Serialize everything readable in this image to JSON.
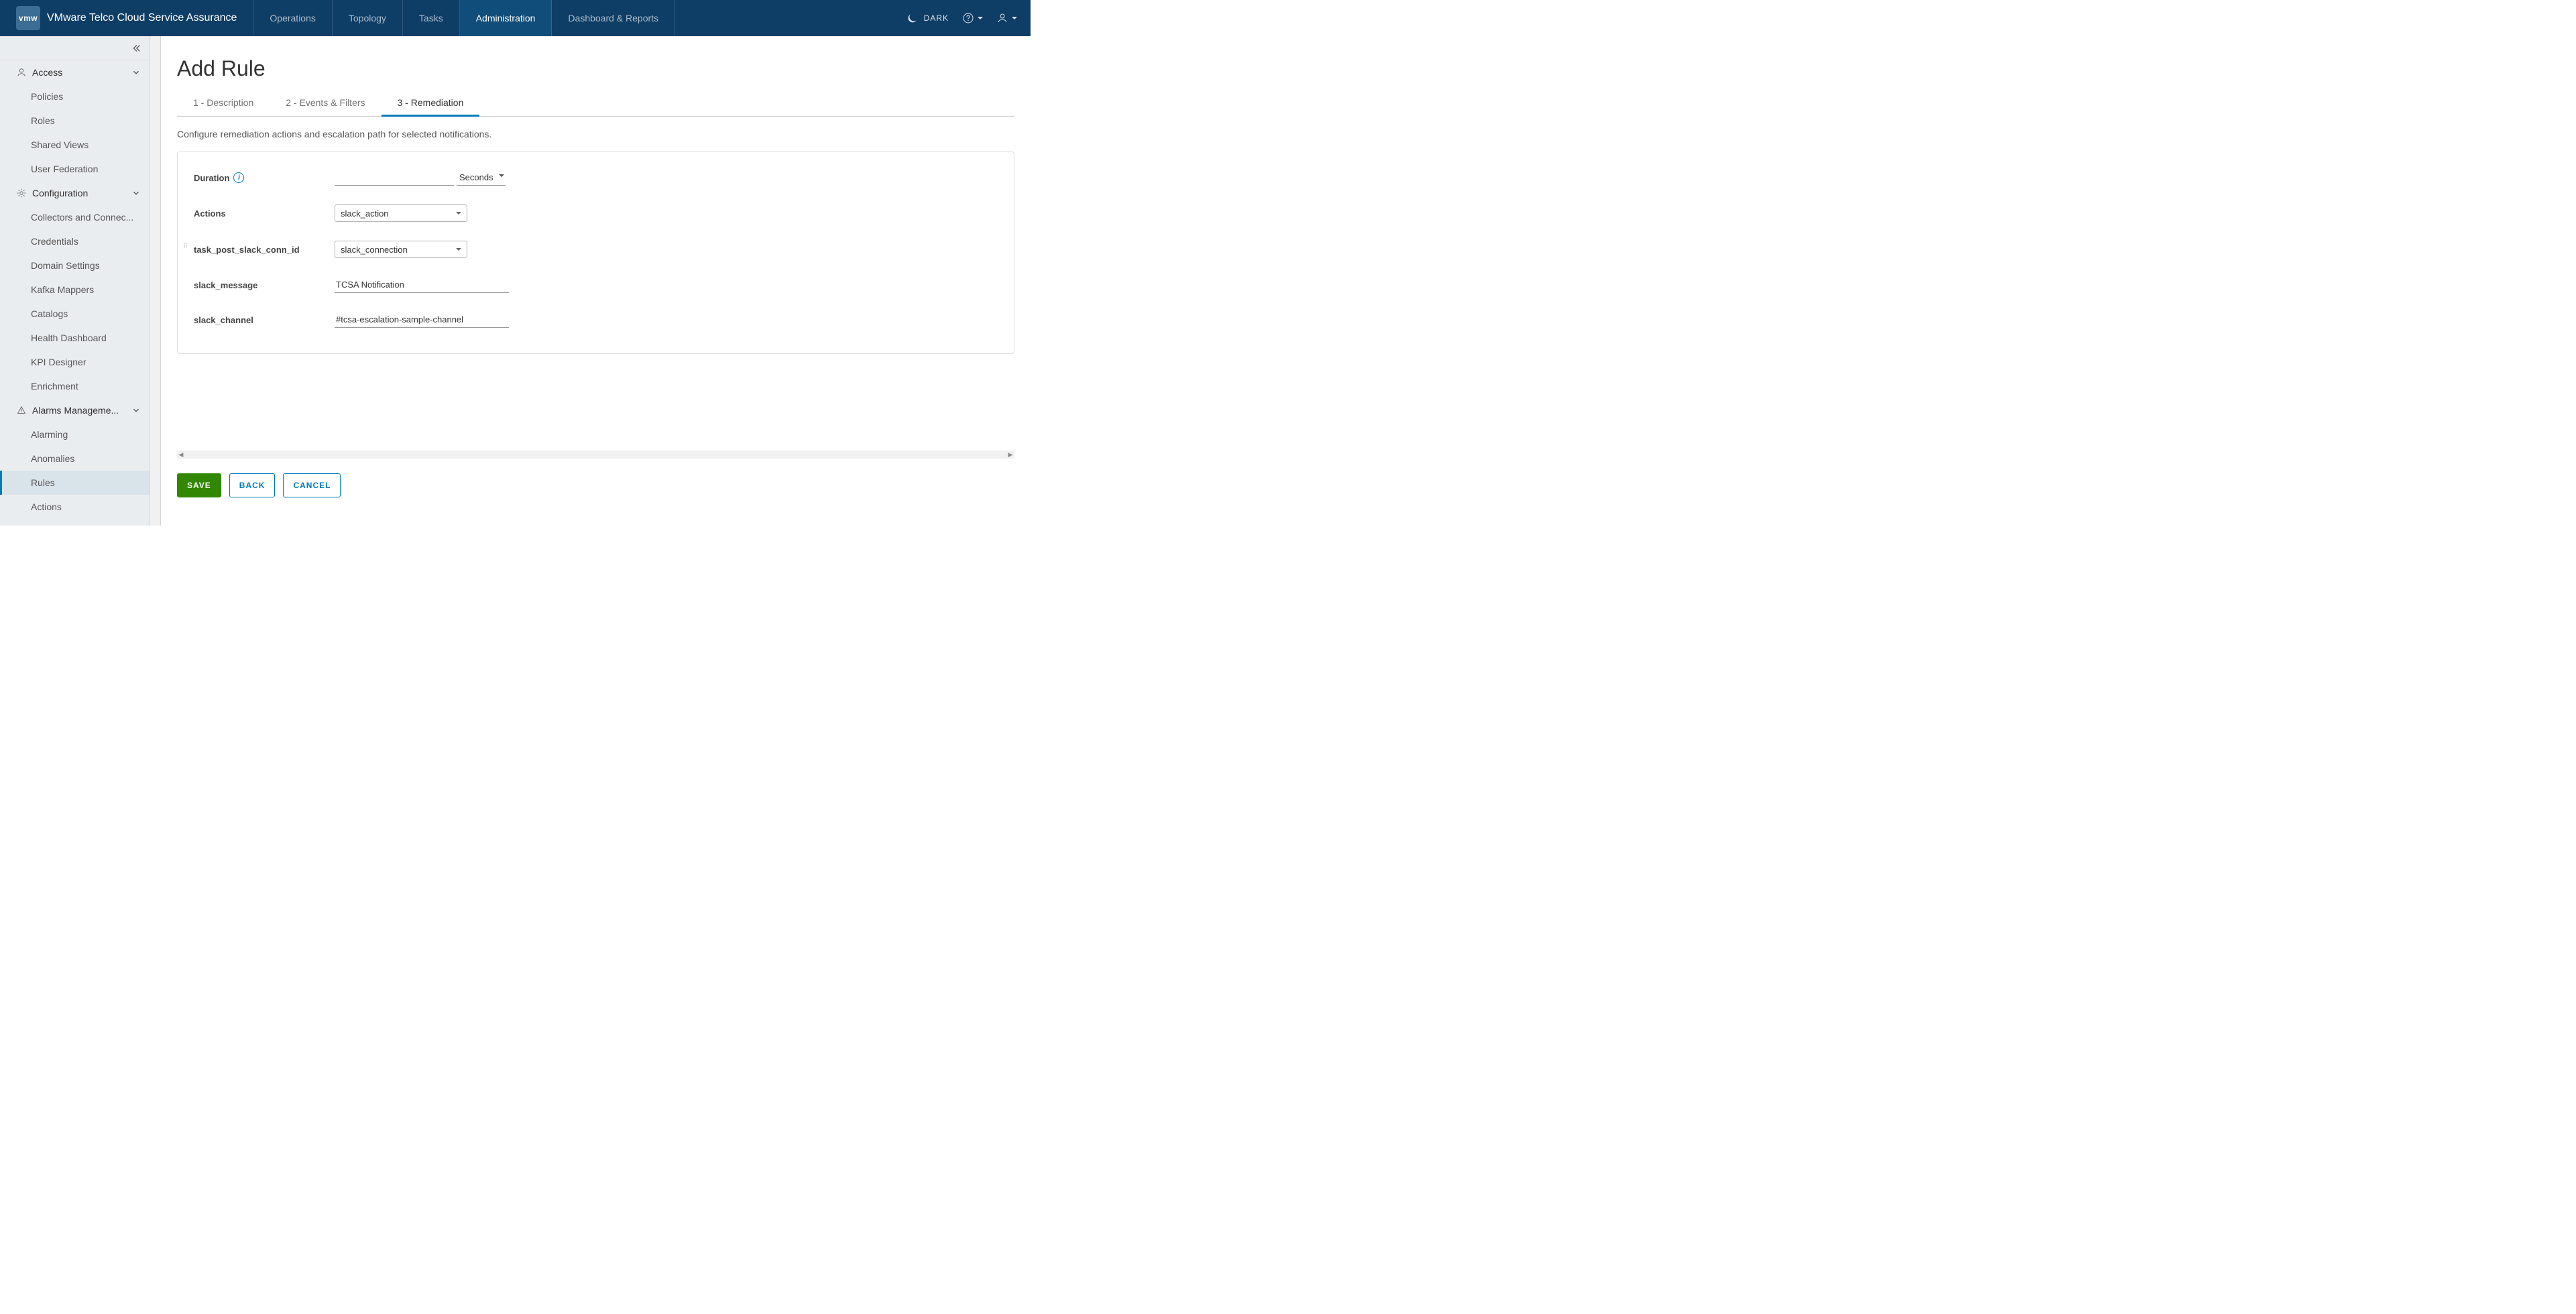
{
  "header": {
    "logo_text": "vmw",
    "product_title": "VMware Telco Cloud Service Assurance",
    "nav": [
      {
        "label": "Operations",
        "active": false
      },
      {
        "label": "Topology",
        "active": false
      },
      {
        "label": "Tasks",
        "active": false
      },
      {
        "label": "Administration",
        "active": true
      },
      {
        "label": "Dashboard & Reports",
        "active": false
      }
    ],
    "theme_label": "DARK"
  },
  "sidenav": {
    "groups": [
      {
        "id": "access",
        "icon": "user-icon",
        "label": "Access",
        "expanded": true,
        "items": [
          {
            "label": "Policies"
          },
          {
            "label": "Roles"
          },
          {
            "label": "Shared Views"
          },
          {
            "label": "User Federation"
          }
        ]
      },
      {
        "id": "configuration",
        "icon": "gear-icon",
        "label": "Configuration",
        "expanded": true,
        "items": [
          {
            "label": "Collectors and Connec..."
          },
          {
            "label": "Credentials"
          },
          {
            "label": "Domain Settings"
          },
          {
            "label": "Kafka Mappers"
          },
          {
            "label": "Catalogs"
          },
          {
            "label": "Health Dashboard"
          },
          {
            "label": "KPI Designer"
          },
          {
            "label": "Enrichment"
          }
        ]
      },
      {
        "id": "alarms",
        "icon": "alarm-icon",
        "label": "Alarms Manageme...",
        "expanded": true,
        "items": [
          {
            "label": "Alarming"
          },
          {
            "label": "Anomalies"
          },
          {
            "label": "Rules",
            "active": true
          },
          {
            "label": "Actions"
          }
        ]
      }
    ]
  },
  "page": {
    "title": "Add Rule",
    "tabs": [
      {
        "label": "1 - Description",
        "active": false
      },
      {
        "label": "2 - Events & Filters",
        "active": false
      },
      {
        "label": "3 - Remediation",
        "active": true
      }
    ],
    "description": "Configure remediation actions and escalation path for selected notifications.",
    "form": {
      "duration_label": "Duration",
      "duration_value": "",
      "duration_unit": "Seconds",
      "actions_label": "Actions",
      "actions_value": "slack_action",
      "conn_label": "task_post_slack_conn_id",
      "conn_value": "slack_connection",
      "message_label": "slack_message",
      "message_value": "TCSA Notification",
      "channel_label": "slack_channel",
      "channel_value": "#tcsa-escalation-sample-channel"
    },
    "buttons": {
      "save": "SAVE",
      "back": "BACK",
      "cancel": "CANCEL"
    }
  }
}
